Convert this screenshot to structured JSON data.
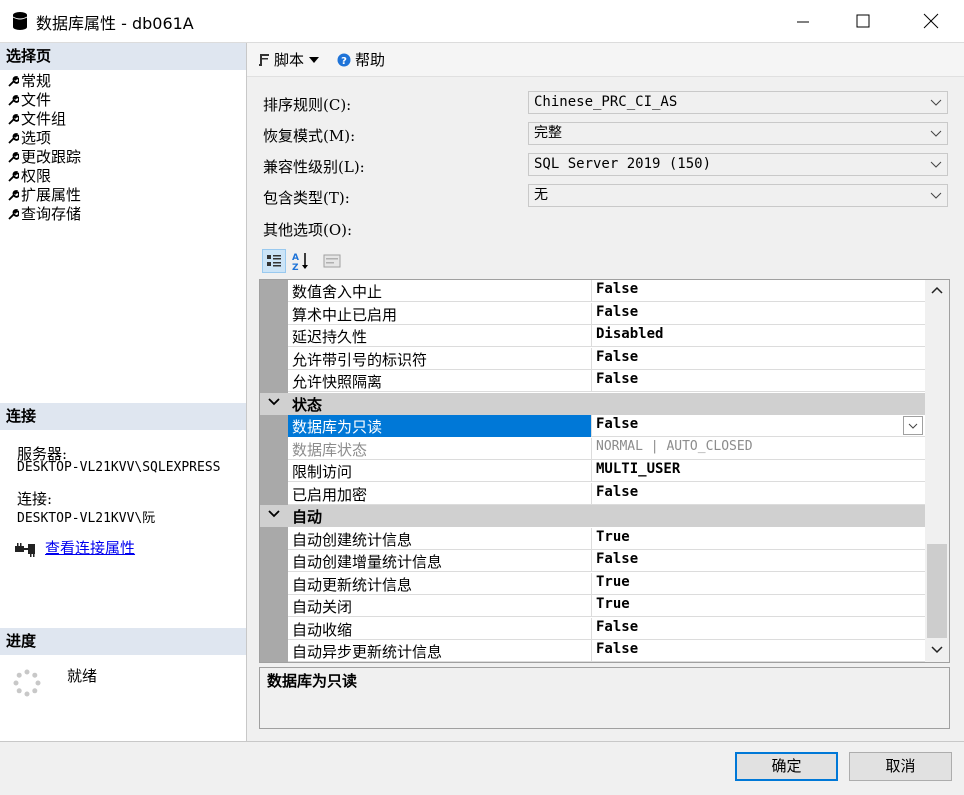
{
  "window": {
    "title": "数据库属性 - db061A"
  },
  "left": {
    "select_page_header": "选择页",
    "nav_items": [
      "常规",
      "文件",
      "文件组",
      "选项",
      "更改跟踪",
      "权限",
      "扩展属性",
      "查询存储"
    ],
    "connection_header": "连接",
    "server_label": "服务器:",
    "server_value": "DESKTOP-VL21KVV\\SQLEXPRESS",
    "connection_label": "连接:",
    "connection_value": "DESKTOP-VL21KVV\\阮",
    "view_conn_props": "查看连接属性",
    "progress_header": "进度",
    "progress_status": "就绪"
  },
  "toolbar": {
    "script_label": "脚本",
    "help_label": "帮助"
  },
  "fields": {
    "collation_label": "排序规则(C):",
    "collation_value": "Chinese_PRC_CI_AS",
    "recovery_label": "恢复模式(M):",
    "recovery_value": "完整",
    "compat_label": "兼容性级别(L):",
    "compat_value": "SQL Server 2019 (150)",
    "containment_label": "包含类型(T):",
    "containment_value": "无",
    "other_options_label": "其他选项(O):"
  },
  "grid": {
    "rows_top": [
      {
        "name": "数值舍入中止",
        "value": "False"
      },
      {
        "name": "算术中止已启用",
        "value": "False"
      },
      {
        "name": "延迟持久性",
        "value": "Disabled"
      },
      {
        "name": "允许带引号的标识符",
        "value": "False"
      },
      {
        "name": "允许快照隔离",
        "value": "False"
      }
    ],
    "cat_state": "状态",
    "state_rows": [
      {
        "name": "数据库为只读",
        "value": "False"
      },
      {
        "name": "数据库状态",
        "value": "NORMAL | AUTO_CLOSED"
      },
      {
        "name": "限制访问",
        "value": "MULTI_USER"
      },
      {
        "name": "已启用加密",
        "value": "False"
      }
    ],
    "cat_auto": "自动",
    "auto_rows": [
      {
        "name": "自动创建统计信息",
        "value": "True"
      },
      {
        "name": "自动创建增量统计信息",
        "value": "False"
      },
      {
        "name": "自动更新统计信息",
        "value": "True"
      },
      {
        "name": "自动关闭",
        "value": "True"
      },
      {
        "name": "自动收缩",
        "value": "False"
      },
      {
        "name": "自动异步更新统计信息",
        "value": "False"
      }
    ],
    "description_title": "数据库为只读"
  },
  "buttons": {
    "ok": "确定",
    "cancel": "取消"
  },
  "colors": {
    "selection": "#0078d7",
    "header_bg": "#dfe6f0",
    "category_bg": "#d0d0d0",
    "link": "#0000ee"
  }
}
